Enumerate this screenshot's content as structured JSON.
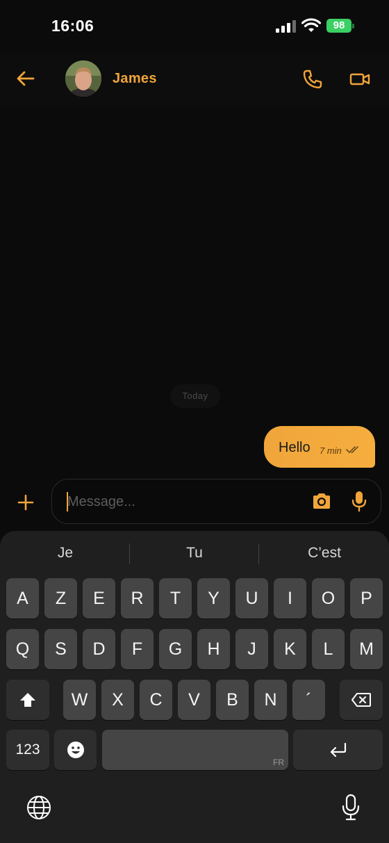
{
  "status": {
    "time": "16:06",
    "battery": "98"
  },
  "header": {
    "contact_name": "James"
  },
  "chat": {
    "date_label": "Today",
    "messages": [
      {
        "text": "Hello",
        "time": "7 min",
        "outgoing": true
      }
    ]
  },
  "composer": {
    "placeholder": "Message..."
  },
  "keyboard": {
    "suggestions": [
      "Je",
      "Tu",
      "C’est"
    ],
    "row1": [
      "A",
      "Z",
      "E",
      "R",
      "T",
      "Y",
      "U",
      "I",
      "O",
      "P"
    ],
    "row2": [
      "Q",
      "S",
      "D",
      "F",
      "G",
      "H",
      "J",
      "K",
      "L",
      "M"
    ],
    "row3": [
      "W",
      "X",
      "C",
      "V",
      "B",
      "N",
      "´"
    ],
    "numbers_key": "123",
    "language": "FR"
  },
  "colors": {
    "accent": "#f0a53a",
    "background": "#0b0b0b",
    "keyboard": "#1f1f1f",
    "key": "#454545"
  }
}
